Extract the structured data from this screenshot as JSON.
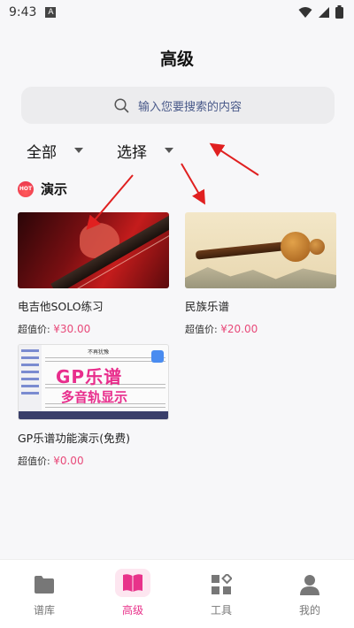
{
  "status_bar": {
    "time": "9:43",
    "notification_letter": "A"
  },
  "header": {
    "title": "高级"
  },
  "search": {
    "placeholder": "输入您要搜索的内容"
  },
  "filters": [
    {
      "label": "全部"
    },
    {
      "label": "选择"
    }
  ],
  "section": {
    "badge": "HOT",
    "title": "演示"
  },
  "cards": [
    {
      "title": "电吉他SOLO练习",
      "price_label": "超值价:",
      "price": "¥30.00"
    },
    {
      "title": "民族乐谱",
      "price_label": "超值价:",
      "price": "¥20.00"
    },
    {
      "title": "GP乐谱功能演示(免费)",
      "price_label": "超值价:",
      "price": "¥0.00",
      "thumb_headline": "GP乐谱",
      "thumb_subline": "多音轨显示",
      "thumb_score_title": "不再犹豫"
    }
  ],
  "bottom_nav": [
    {
      "label": "谱库",
      "icon": "folder-icon"
    },
    {
      "label": "高级",
      "icon": "book-icon",
      "active": true
    },
    {
      "label": "工具",
      "icon": "grid-icon"
    },
    {
      "label": "我的",
      "icon": "person-icon"
    }
  ],
  "colors": {
    "accent": "#e8328a",
    "price": "#e84a7a",
    "arrow": "#e02020"
  }
}
